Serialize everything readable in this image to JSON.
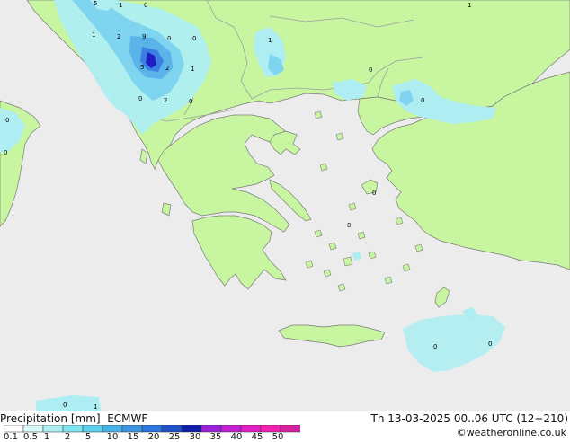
{
  "title": {
    "left": "Precipitation [mm]  ECMWF",
    "right": "Th 13-03-2025 00..06 UTC (12+210)"
  },
  "credit": "©weatheronline.co.uk",
  "colors": {
    "sea": "#ececec",
    "land": "#c7f5a0",
    "border": "#9aa0a0",
    "coast": "#7a7a7a",
    "precip_light": "#aeeef2",
    "precip_mid": "#7fd4f0",
    "precip_heavy": "#3b7fe0",
    "precip_max": "#1f1fbf"
  },
  "legend": {
    "ticks": [
      "0.1",
      "0.5",
      "1",
      "2",
      "5",
      "10",
      "15",
      "20",
      "25",
      "30",
      "35",
      "40",
      "45",
      "50"
    ],
    "colors": [
      "#ffffff",
      "#d8f7f8",
      "#aeeef2",
      "#7fe3ee",
      "#5ccfe9",
      "#46b3e6",
      "#3a94e2",
      "#2d74db",
      "#1f4fc9",
      "#0c1ea8",
      "#9b1fd8",
      "#c21fd0",
      "#e11fc4",
      "#f21fb0",
      "#d6209e"
    ]
  },
  "map_labels": [
    {
      "text": "5"
    },
    {
      "text": "1"
    },
    {
      "text": "0"
    },
    {
      "text": "1"
    },
    {
      "text": "1"
    },
    {
      "text": "2"
    },
    {
      "text": "9"
    },
    {
      "text": "0"
    },
    {
      "text": "0"
    },
    {
      "text": "1"
    },
    {
      "text": "5"
    },
    {
      "text": "2"
    },
    {
      "text": "1"
    },
    {
      "text": "0"
    },
    {
      "text": "0"
    },
    {
      "text": "2"
    },
    {
      "text": "0"
    },
    {
      "text": "0"
    },
    {
      "text": "0"
    },
    {
      "text": "0"
    },
    {
      "text": "0"
    },
    {
      "text": "0"
    },
    {
      "text": "0"
    },
    {
      "text": "0"
    },
    {
      "text": "0"
    },
    {
      "text": "1"
    }
  ]
}
